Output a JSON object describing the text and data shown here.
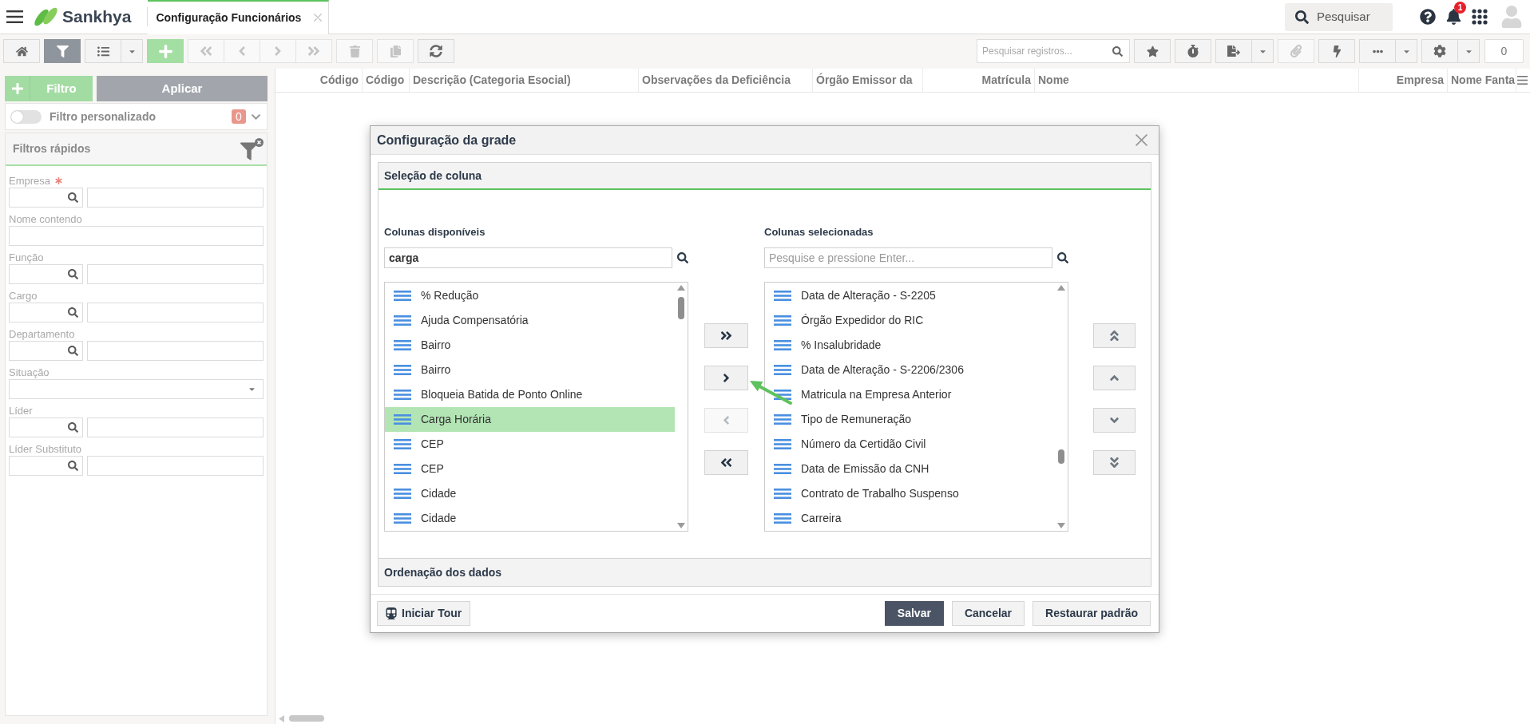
{
  "top_bar": {
    "logo": "Sankhya",
    "tabs": [
      {
        "title": "Configuração Funcionários",
        "selected": true
      }
    ],
    "search": {
      "placeholder": "Pesquisar"
    },
    "notifications": {
      "count": "1"
    }
  },
  "toolbar": {
    "left_groups": [
      [
        {
          "kind": "home",
          "active": false,
          "disabled": false,
          "dropdown": false
        }
      ],
      [
        {
          "kind": "filter",
          "active": true,
          "disabled": false,
          "dropdown": false
        }
      ],
      [
        {
          "kind": "list",
          "active": false,
          "disabled": false,
          "dropdown": true
        }
      ],
      [
        {
          "kind": "add",
          "active": false,
          "disabled": false,
          "dropdown": false
        }
      ],
      [
        {
          "kind": "first",
          "active": false,
          "disabled": true,
          "dropdown": false
        },
        {
          "kind": "previous",
          "active": false,
          "disabled": true,
          "dropdown": false
        },
        {
          "kind": "next",
          "active": false,
          "disabled": true,
          "dropdown": false
        },
        {
          "kind": "last",
          "active": false,
          "disabled": true,
          "dropdown": false
        }
      ],
      [
        {
          "kind": "delete",
          "active": false,
          "disabled": true,
          "dropdown": false
        }
      ],
      [
        {
          "kind": "copy",
          "active": false,
          "disabled": true,
          "dropdown": false
        }
      ],
      [
        {
          "kind": "refresh",
          "active": false,
          "disabled": false,
          "dropdown": false
        }
      ]
    ],
    "search": {
      "placeholder": "Pesquisar registros..."
    },
    "right_groups": [
      [
        {
          "kind": "favorite",
          "active": false,
          "disabled": false,
          "dropdown": false
        }
      ],
      [
        {
          "kind": "timer",
          "active": false,
          "disabled": false,
          "dropdown": false
        }
      ],
      [
        {
          "kind": "export",
          "active": false,
          "disabled": false,
          "dropdown": true
        }
      ],
      [
        {
          "kind": "attach",
          "active": false,
          "disabled": true,
          "dropdown": false
        }
      ],
      [
        {
          "kind": "action",
          "active": false,
          "disabled": false,
          "dropdown": false
        }
      ],
      [
        {
          "kind": "more",
          "active": false,
          "disabled": false,
          "dropdown": true
        }
      ],
      [
        {
          "kind": "settings",
          "active": false,
          "disabled": false,
          "dropdown": true
        }
      ]
    ],
    "record_count": "0"
  },
  "filter_panel": {
    "add_button": "Filtro",
    "apply_button": "Aplicar",
    "custom_filter": {
      "label": "Filtro personalizado",
      "on": false,
      "count": "0"
    },
    "quick_filters": {
      "title": "Filtros rápidos",
      "fields": [
        {
          "label": "Empresa",
          "required": true,
          "kind": "lookup"
        },
        {
          "label": "Nome contendo",
          "required": false,
          "kind": "text"
        },
        {
          "label": "Função",
          "required": false,
          "kind": "lookup"
        },
        {
          "label": "Cargo",
          "required": false,
          "kind": "lookup"
        },
        {
          "label": "Departamento",
          "required": false,
          "kind": "lookup"
        },
        {
          "label": "Situação",
          "required": false,
          "kind": "select"
        },
        {
          "label": "Líder",
          "required": false,
          "kind": "lookup"
        },
        {
          "label": "Líder Substituto",
          "required": false,
          "kind": "lookup"
        }
      ]
    }
  },
  "grid": {
    "columns": [
      "Código",
      "Código",
      "Descrição (Categoria Esocial)",
      "Observações da Deficiência",
      "Órgão Emissor da",
      "Matrícula",
      "Nome",
      "Empresa",
      "Nome Fanta"
    ]
  },
  "dialog": {
    "title": "Configuração da grade",
    "sections": [
      {
        "title": "Seleção de coluna",
        "expanded": true,
        "available": {
          "title": "Colunas disponíveis",
          "search_value": "carga",
          "items": [
            {
              "label": "% Redução",
              "selected": false
            },
            {
              "label": "Ajuda Compensatória",
              "selected": false
            },
            {
              "label": "Bairro",
              "selected": false
            },
            {
              "label": "Bairro",
              "selected": false
            },
            {
              "label": "Bloqueia Batida de Ponto Online",
              "selected": false
            },
            {
              "label": "Carga Horária",
              "selected": true
            },
            {
              "label": "CEP",
              "selected": false
            },
            {
              "label": "CEP",
              "selected": false
            },
            {
              "label": "Cidade",
              "selected": false
            },
            {
              "label": "Cidade",
              "selected": false
            }
          ]
        },
        "transfer_buttons": [
          {
            "kind": "add-all",
            "disabled": false
          },
          {
            "kind": "add",
            "disabled": false
          },
          {
            "kind": "remove",
            "disabled": true
          },
          {
            "kind": "remove-all",
            "disabled": false
          }
        ],
        "chosen": {
          "title": "Colunas selecionadas",
          "placeholder": "Pesquise e pressione Enter...",
          "items": [
            {
              "label": "Data de Alteração - S-2205",
              "selected": false
            },
            {
              "label": "Órgão Expedidor do RIC",
              "selected": false
            },
            {
              "label": "% Insalubridade",
              "selected": false
            },
            {
              "label": "Data de Alteração - S-2206/2306",
              "selected": false
            },
            {
              "label": "Matricula na Empresa Anterior",
              "selected": false
            },
            {
              "label": "Tipo de Remuneração",
              "selected": false
            },
            {
              "label": "Número da Certidão Civil",
              "selected": false
            },
            {
              "label": "Data de Emissão da CNH",
              "selected": false
            },
            {
              "label": "Contrato de Trabalho Suspenso",
              "selected": false
            },
            {
              "label": "Carreira",
              "selected": false
            }
          ]
        },
        "order_buttons": [
          {
            "kind": "top",
            "disabled": false
          },
          {
            "kind": "up",
            "disabled": false
          },
          {
            "kind": "down",
            "disabled": false
          },
          {
            "kind": "bottom",
            "disabled": false
          }
        ]
      },
      {
        "title": "Ordenação dos dados",
        "expanded": false
      }
    ],
    "footer": {
      "tour_button": "Iniciar Tour",
      "buttons": [
        {
          "label": "Salvar",
          "kind": "save"
        },
        {
          "label": "Cancelar",
          "kind": "cancel"
        },
        {
          "label": "Restaurar padrão",
          "kind": "reset"
        }
      ]
    }
  }
}
